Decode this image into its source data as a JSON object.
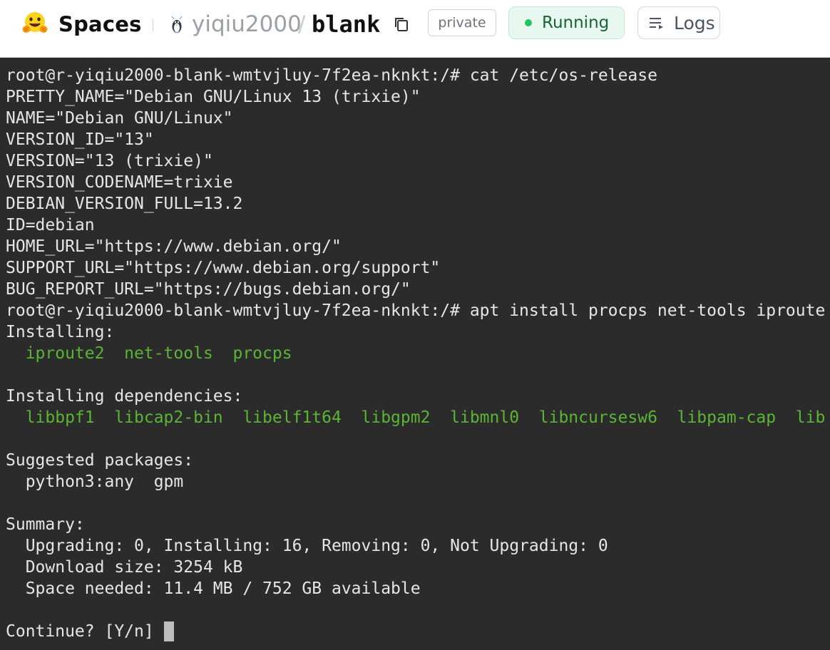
{
  "header": {
    "brand": "Spaces",
    "owner": "yiqiu2000",
    "separator": "/",
    "repo": "blank",
    "visibility_badge": "private",
    "status_label": "Running",
    "logs_label": "Logs",
    "colors": {
      "running_bg": "#e8f8f0",
      "running_dot": "#22c55e",
      "running_text": "#166534"
    },
    "icons": {
      "logo": "hugging-face-emoji-icon",
      "owner_avatar": "owner-avatar-icon",
      "copy": "copy-icon",
      "status": "status-dot-icon",
      "logs": "logs-list-icon"
    }
  },
  "terminal": {
    "background": "#2b2b2b",
    "text_color": "#e6e6e6",
    "accent_green": "#5bb535",
    "lines": [
      {
        "text": "root@r-yiqiu2000-blank-wmtvjluy-7f2ea-nknkt:/# cat /etc/os-release",
        "kind": "normal"
      },
      {
        "text": "PRETTY_NAME=\"Debian GNU/Linux 13 (trixie)\"",
        "kind": "normal"
      },
      {
        "text": "NAME=\"Debian GNU/Linux\"",
        "kind": "normal"
      },
      {
        "text": "VERSION_ID=\"13\"",
        "kind": "normal"
      },
      {
        "text": "VERSION=\"13 (trixie)\"",
        "kind": "normal"
      },
      {
        "text": "VERSION_CODENAME=trixie",
        "kind": "normal"
      },
      {
        "text": "DEBIAN_VERSION_FULL=13.2",
        "kind": "normal"
      },
      {
        "text": "ID=debian",
        "kind": "normal"
      },
      {
        "text": "HOME_URL=\"https://www.debian.org/\"",
        "kind": "normal"
      },
      {
        "text": "SUPPORT_URL=\"https://www.debian.org/support\"",
        "kind": "normal"
      },
      {
        "text": "BUG_REPORT_URL=\"https://bugs.debian.org/\"",
        "kind": "normal"
      },
      {
        "text": "root@r-yiqiu2000-blank-wmtvjluy-7f2ea-nknkt:/# apt install procps net-tools iproute",
        "kind": "normal"
      },
      {
        "text": "Installing:",
        "kind": "normal"
      },
      {
        "text": "  iproute2  net-tools  procps",
        "kind": "green"
      },
      {
        "text": "",
        "kind": "normal"
      },
      {
        "text": "Installing dependencies:",
        "kind": "normal"
      },
      {
        "text": "  libbpf1  libcap2-bin  libelf1t64  libgpm2  libmnl0  libncursesw6  libpam-cap  lib",
        "kind": "green"
      },
      {
        "text": "",
        "kind": "normal"
      },
      {
        "text": "Suggested packages:",
        "kind": "normal"
      },
      {
        "text": "  python3:any  gpm",
        "kind": "normal"
      },
      {
        "text": "",
        "kind": "normal"
      },
      {
        "text": "Summary:",
        "kind": "normal"
      },
      {
        "text": "  Upgrading: 0, Installing: 16, Removing: 0, Not Upgrading: 0",
        "kind": "normal"
      },
      {
        "text": "  Download size: 3254 kB",
        "kind": "normal"
      },
      {
        "text": "  Space needed: 11.4 MB / 752 GB available",
        "kind": "normal"
      },
      {
        "text": "",
        "kind": "normal"
      },
      {
        "text": "Continue? [Y/n] ",
        "kind": "prompt"
      }
    ]
  }
}
